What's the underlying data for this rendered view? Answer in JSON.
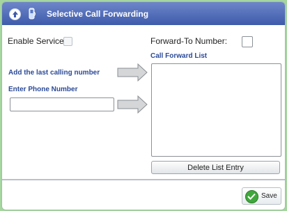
{
  "header": {
    "title": "Selective Call Forwarding",
    "collapse_icon": "collapse-up-icon",
    "phone_icon": "phone-icon"
  },
  "form": {
    "enable_service_label": "Enable Service:",
    "enable_service_checked": false,
    "forward_to_label": "Forward-To Number:",
    "forward_to_value": "",
    "call_forward_list_label": "Call Forward List",
    "call_forward_list_items": [],
    "add_last_calling_label": "Add the last calling number",
    "enter_phone_label": "Enter Phone Number",
    "phone_value": "",
    "delete_label": "Delete List Entry"
  },
  "footer": {
    "save_label": "Save"
  },
  "colors": {
    "titlebar": "#3e5bab",
    "background": "#a6d6a0",
    "accent_text": "#2b4a96",
    "save_icon": "#3fa83c"
  }
}
